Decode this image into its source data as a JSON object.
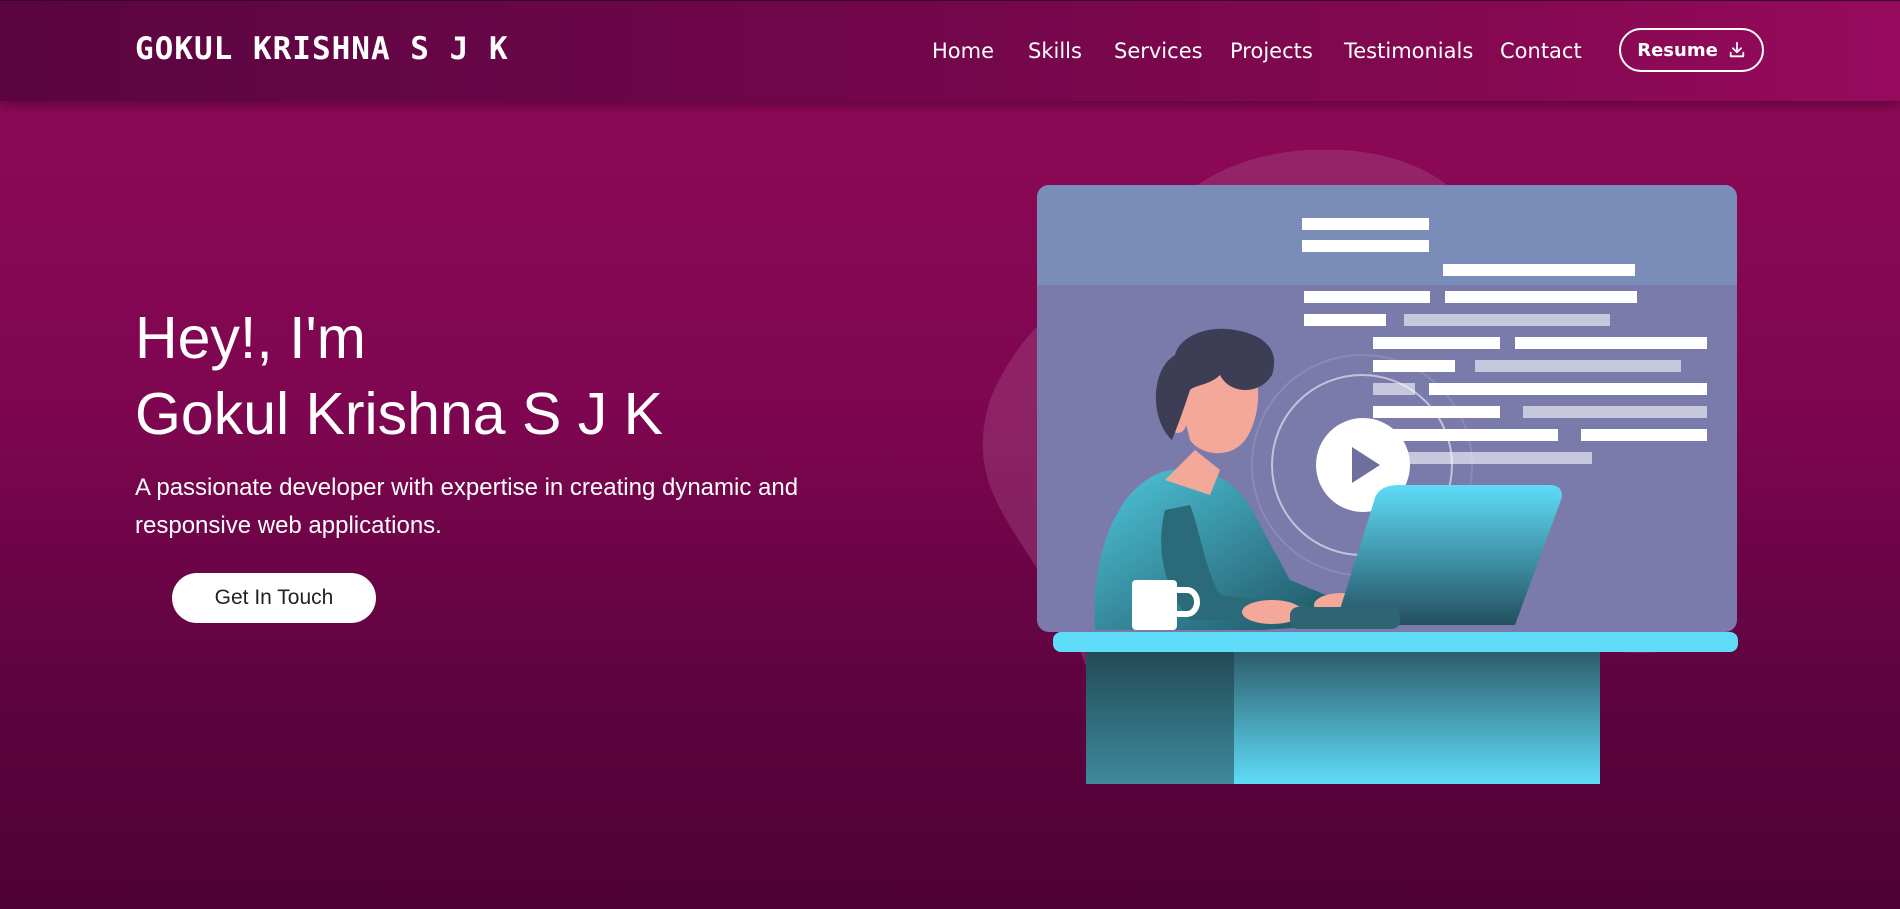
{
  "nav": {
    "brand": "GOKUL KRISHNA S J K",
    "links": [
      "Home",
      "Skills",
      "Services",
      "Projects",
      "Testimonials",
      "Contact"
    ],
    "resume_label": "Resume",
    "resume_icon": "download-icon"
  },
  "hero": {
    "greeting": "Hey!, I'm",
    "name": "Gokul Krishna S J K",
    "description": "A passionate developer with expertise in creating dynamic and responsive web applications.",
    "cta_label": "Get In Touch",
    "illustration_icon": "developer-at-laptop-illustration",
    "play_icon": "play-icon"
  },
  "colors": {
    "background_top": "#920a58",
    "background_bottom": "#4e0236",
    "accent": "#5fdcf8",
    "screen": "#7a7bab"
  }
}
